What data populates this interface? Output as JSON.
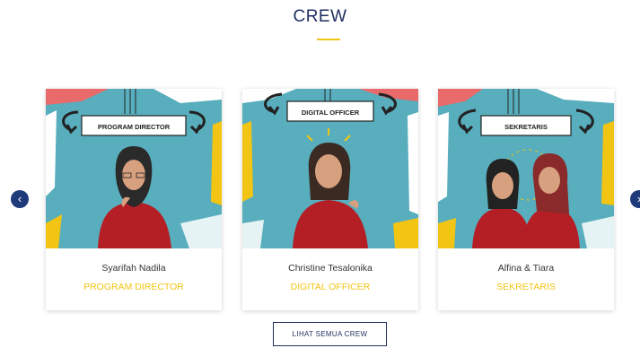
{
  "section": {
    "title": "CREW"
  },
  "crew": [
    {
      "banner": "PROGRAM DIRECTOR",
      "name": "Syarifah Nadila",
      "role": "PROGRAM DIRECTOR"
    },
    {
      "banner": "DIGITAL OFFICER",
      "name": "Christine Tesalonika",
      "role": "DIGITAL OFFICER"
    },
    {
      "banner": "SEKRETARIS",
      "name": "Alfina & Tiara",
      "role": "SEKRETARIS"
    }
  ],
  "carousel": {
    "prev_icon": "chevron-left-icon",
    "next_icon": "chevron-right-icon",
    "prev_glyph": "‹",
    "next_glyph": "›"
  },
  "cta": {
    "see_all_label": "LIHAT SEMUA CREW"
  },
  "colors": {
    "title": "#1f2f5e",
    "accent": "#f2c514",
    "nav": "#1f3a7a",
    "photo_bg": "#58aebd",
    "shirt": "#b41f26"
  }
}
